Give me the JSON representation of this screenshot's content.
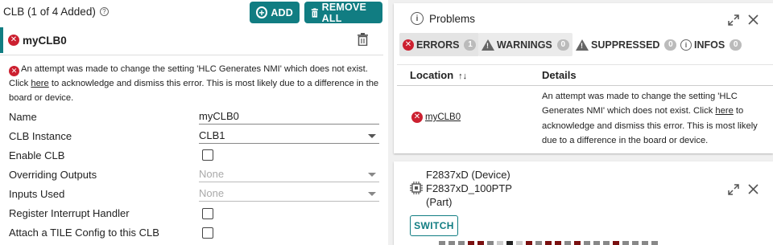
{
  "header": {
    "title": "CLB (1 of 4 Added)",
    "help_glyph": "?"
  },
  "toolbar": {
    "add_label": "ADD",
    "remove_all_label": "REMOVE ALL",
    "accent": "#117d82"
  },
  "instance": {
    "name": "myCLB0"
  },
  "error_message": {
    "text_before": "An attempt was made to change the setting 'HLC Generates NMI' which does not exist. Click ",
    "link": "here",
    "text_after": " to acknowledge and dismiss this error. This is most likely due to a difference in the board or device."
  },
  "fields": {
    "name": {
      "label": "Name",
      "value": "myCLB0"
    },
    "clb_instance": {
      "label": "CLB Instance",
      "value": "CLB1"
    },
    "enable_clb": {
      "label": "Enable CLB",
      "checked": false
    },
    "overriding_outputs": {
      "label": "Overriding Outputs",
      "value": "None"
    },
    "inputs_used": {
      "label": "Inputs Used",
      "value": "None"
    },
    "register_interrupt_handler": {
      "label": "Register Interrupt Handler",
      "checked": false
    },
    "attach_tile_config": {
      "label": "Attach a TILE Config to this CLB",
      "checked": false
    }
  },
  "problems": {
    "title": "Problems",
    "tabs": [
      {
        "label": "ERRORS",
        "count": "1"
      },
      {
        "label": "WARNINGS",
        "count": "0"
      },
      {
        "label": "SUPPRESSED",
        "count": "0"
      },
      {
        "label": "INFOS",
        "count": "0"
      }
    ],
    "columns": {
      "location": "Location",
      "details": "Details"
    },
    "row": {
      "location": "myCLB0",
      "details_before": "An attempt was made to change the setting 'HLC Generates NMI' which does not exist. Click ",
      "details_link": "here",
      "details_after": " to acknowledge and dismiss this error. This is most likely due to a difference in the board or device."
    },
    "error_color": "#cc2030"
  },
  "device": {
    "device_line": "F2837xD (Device)",
    "part_line": "F2837xD_100PTP",
    "part_suffix": "(Part)",
    "switch_label": "SWITCH"
  },
  "icons": [
    "help-icon",
    "plus-circle-icon",
    "trash-icon",
    "error-icon",
    "info-icon",
    "expand-icon",
    "close-icon",
    "warning-icon",
    "sort-icon",
    "chip-icon"
  ]
}
